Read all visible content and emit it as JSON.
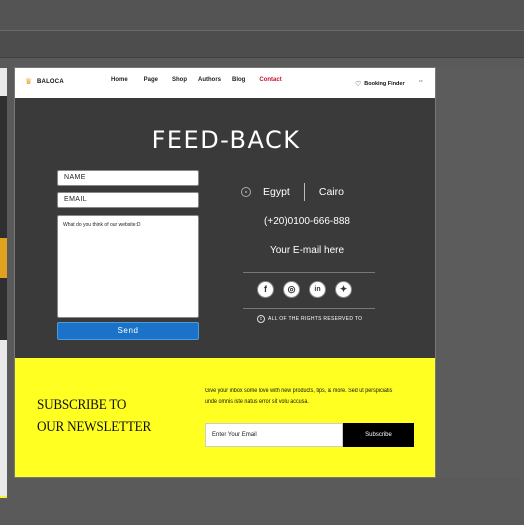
{
  "nav": {
    "brand": "BALOCA",
    "items": [
      {
        "label": "Home",
        "active": false
      },
      {
        "label": "Page",
        "active": false
      },
      {
        "label": "Shop",
        "active": false
      },
      {
        "label": "Authors",
        "active": false
      },
      {
        "label": "Blog",
        "active": false
      },
      {
        "label": "Contact",
        "active": true
      }
    ],
    "booking_label": "Booking Finder",
    "more_glyph": "··"
  },
  "feedback": {
    "title": "FEED-BACK",
    "name_placeholder": "NAME",
    "email_placeholder": "EMAIL",
    "message_text": "What do you think of our website:D",
    "send_label": "Send"
  },
  "contact": {
    "country": "Egypt",
    "city": "Cairo",
    "phone": "(+20)0100-666-888",
    "email": "Your E-mail here",
    "socials": [
      {
        "icon": "facebook-icon",
        "glyph": "f"
      },
      {
        "icon": "instagram-icon",
        "glyph": "◎"
      },
      {
        "icon": "linkedin-icon",
        "glyph": "in"
      },
      {
        "icon": "twitter-icon",
        "glyph": "✦"
      }
    ],
    "rights": "ALL OF THE RIGHTS RESERVED TO",
    "copyright_glyph": "c"
  },
  "newsletter": {
    "title_line1": "SUBSCRIBE TO",
    "title_line2": "OUR NEWSLETTER",
    "description": "Give your inbox some love with new products, tips, & more. Sed ut perspiciatis unde omnis iste natus error sit volu accusa.",
    "input_placeholder": "Enter Your Email",
    "button_label": "Subscribe"
  },
  "colors": {
    "accent_blue": "#1a73c8",
    "newsletter_yellow": "#ffff22",
    "active_nav_red": "#c8102e",
    "panel_dark": "#3a3a3a"
  }
}
